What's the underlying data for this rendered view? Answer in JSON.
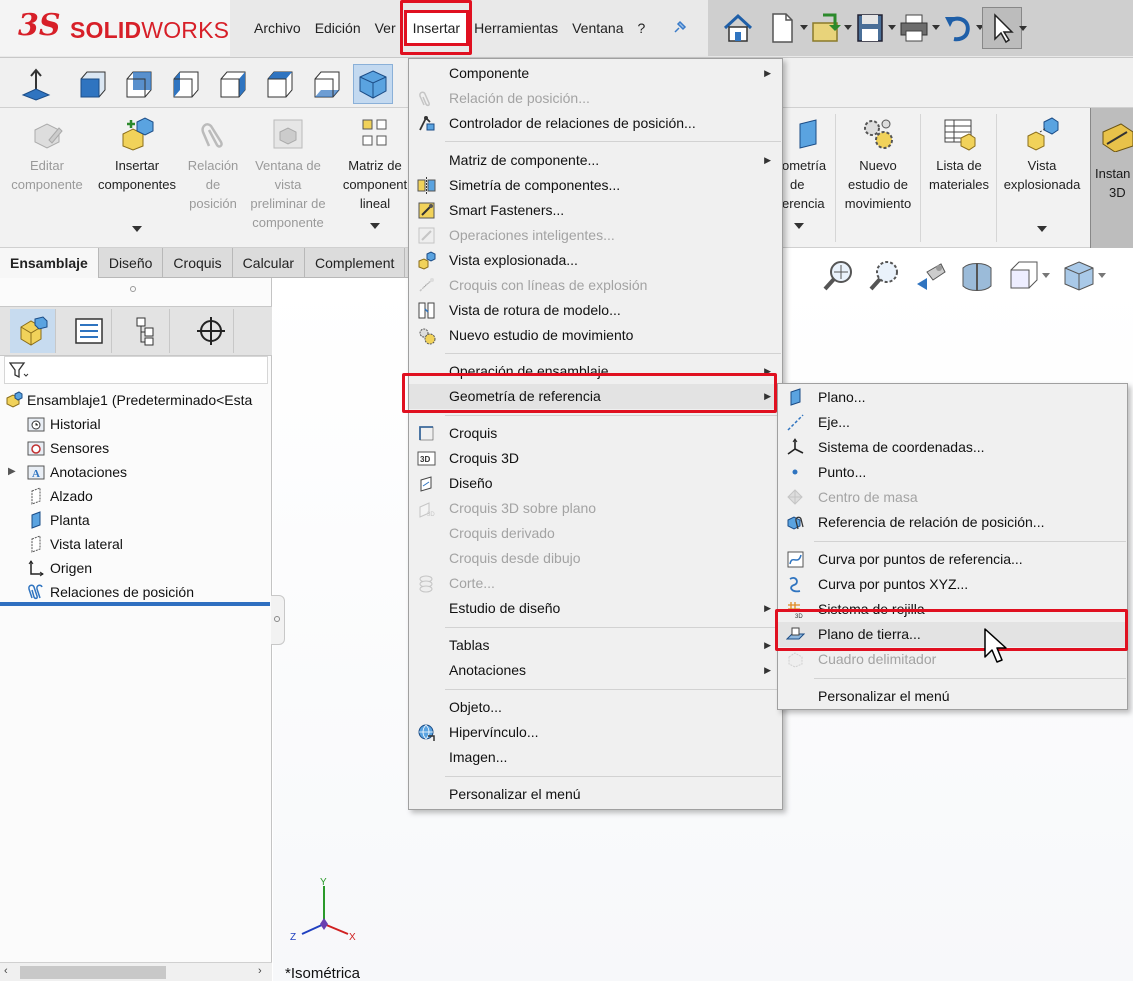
{
  "app": {
    "logo_mark": "3S",
    "logo_bold": "SOLID",
    "logo_light": "WORKS",
    "brand_color": "#d71f28",
    "highlight_color": "#e01020"
  },
  "menubar": {
    "items": [
      "Archivo",
      "Edición",
      "Ver",
      "Insertar",
      "Herramientas",
      "Ventana",
      "?"
    ],
    "active": "Insertar"
  },
  "quick_access": {
    "icons": [
      "home-icon",
      "new-document-icon",
      "open-icon",
      "save-icon",
      "print-icon",
      "undo-icon",
      "select-pointer-icon"
    ]
  },
  "command_manager": {
    "buttons": [
      {
        "l1": "Editar",
        "l2": "componente",
        "l3": "",
        "l4": "",
        "enabled": false
      },
      {
        "l1": "Insertar",
        "l2": "componentes",
        "l3": "",
        "l4": "",
        "enabled": true
      },
      {
        "l1": "Relación",
        "l2": "de",
        "l3": "posición",
        "l4": "",
        "enabled": false
      },
      {
        "l1": "Ventana de",
        "l2": "vista",
        "l3": "preliminar de",
        "l4": "componente",
        "enabled": false
      },
      {
        "l1": "Matriz de",
        "l2": "component",
        "l3": "lineal",
        "l4": "",
        "enabled": true
      },
      {
        "l1": "ometría",
        "l2": "de",
        "l3": "erencia",
        "l4": "",
        "enabled": true
      },
      {
        "l1": "Nuevo",
        "l2": "estudio de",
        "l3": "movimiento",
        "l4": "",
        "enabled": true
      },
      {
        "l1": "Lista de",
        "l2": "materiales",
        "l3": "",
        "l4": "",
        "enabled": true
      },
      {
        "l1": "Vista",
        "l2": "explosionada",
        "l3": "",
        "l4": "",
        "enabled": true
      },
      {
        "l1": "Instan",
        "l2": "3D",
        "l3": "",
        "l4": "",
        "enabled": true
      }
    ]
  },
  "tabs": [
    "Ensamblaje",
    "Diseño",
    "Croquis",
    "Calcular",
    "Complement"
  ],
  "active_tab": "Ensamblaje",
  "feature_tree": {
    "root": "Ensamblaje1  (Predeterminado<Esta",
    "items": [
      "Historial",
      "Sensores",
      "Anotaciones",
      "Alzado",
      "Planta",
      "Vista lateral",
      "Origen",
      "Relaciones de posición"
    ]
  },
  "insert_menu": {
    "items": [
      {
        "label": "Componente",
        "enabled": true,
        "submenu": true
      },
      {
        "label": "Relación de posición...",
        "enabled": false,
        "submenu": false
      },
      {
        "label": "Controlador de relaciones de posición...",
        "enabled": true,
        "submenu": false
      },
      {
        "label": "Matriz de componente...",
        "enabled": true,
        "submenu": true
      },
      {
        "label": "Simetría de componentes...",
        "enabled": true,
        "submenu": false
      },
      {
        "label": "Smart Fasteners...",
        "enabled": true,
        "submenu": false
      },
      {
        "label": "Operaciones inteligentes...",
        "enabled": false,
        "submenu": false
      },
      {
        "label": "Vista explosionada...",
        "enabled": true,
        "submenu": false
      },
      {
        "label": "Croquis con líneas de explosión",
        "enabled": false,
        "submenu": false
      },
      {
        "label": "Vista de rotura de modelo...",
        "enabled": true,
        "submenu": false
      },
      {
        "label": "Nuevo estudio de movimiento",
        "enabled": true,
        "submenu": false
      },
      {
        "label": "Operación de ensamblaje",
        "enabled": true,
        "submenu": true
      },
      {
        "label": "Geometría de referencia",
        "enabled": true,
        "submenu": true
      },
      {
        "label": "Croquis",
        "enabled": true,
        "submenu": false
      },
      {
        "label": "Croquis 3D",
        "enabled": true,
        "submenu": false
      },
      {
        "label": "Diseño",
        "enabled": true,
        "submenu": false
      },
      {
        "label": "Croquis 3D sobre plano",
        "enabled": false,
        "submenu": false
      },
      {
        "label": "Croquis derivado",
        "enabled": false,
        "submenu": false
      },
      {
        "label": "Croquis desde dibujo",
        "enabled": false,
        "submenu": false
      },
      {
        "label": "Corte...",
        "enabled": false,
        "submenu": false
      },
      {
        "label": "Estudio de diseño",
        "enabled": true,
        "submenu": true
      },
      {
        "label": "Tablas",
        "enabled": true,
        "submenu": true
      },
      {
        "label": "Anotaciones",
        "enabled": true,
        "submenu": true
      },
      {
        "label": "Objeto...",
        "enabled": true,
        "submenu": false
      },
      {
        "label": "Hipervínculo...",
        "enabled": true,
        "submenu": false
      },
      {
        "label": "Imagen...",
        "enabled": true,
        "submenu": false
      },
      {
        "label": "Personalizar el menú",
        "enabled": true,
        "submenu": false
      }
    ],
    "highlighted": "Geometría de referencia"
  },
  "reference_geometry_submenu": {
    "items": [
      {
        "label": "Plano...",
        "enabled": true
      },
      {
        "label": "Eje...",
        "enabled": true
      },
      {
        "label": "Sistema de coordenadas...",
        "enabled": true
      },
      {
        "label": "Punto...",
        "enabled": true
      },
      {
        "label": "Centro de masa",
        "enabled": false
      },
      {
        "label": "Referencia de relación de posición...",
        "enabled": true
      },
      {
        "label": "Curva por puntos de referencia...",
        "enabled": true
      },
      {
        "label": "Curva por puntos XYZ...",
        "enabled": true
      },
      {
        "label": "Sistema de rejilla",
        "enabled": true
      },
      {
        "label": "Plano de tierra...",
        "enabled": true
      },
      {
        "label": "Cuadro delimitador",
        "enabled": false
      },
      {
        "label": "Personalizar el menú",
        "enabled": true
      }
    ],
    "highlighted": "Plano de tierra..."
  },
  "viewport": {
    "view_name": "*Isométrica",
    "triad": {
      "x": "X",
      "y": "Y",
      "z": "Z"
    }
  }
}
